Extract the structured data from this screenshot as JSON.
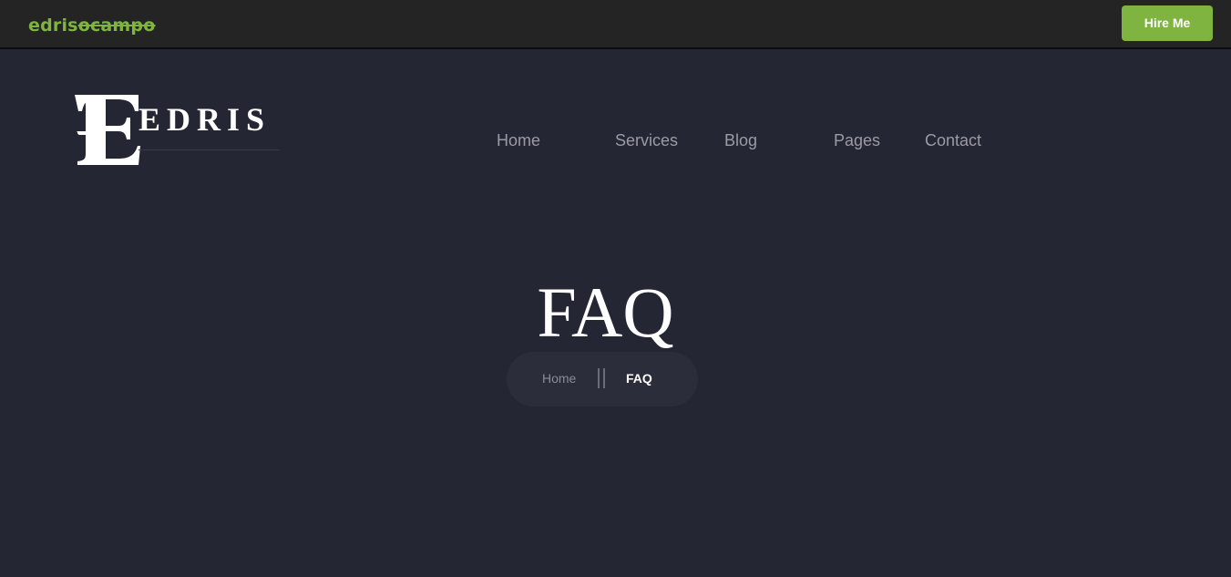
{
  "topbar": {
    "brand_prefix": "edris",
    "brand_suffix": "ocampo",
    "hire_button": "Hire Me"
  },
  "logo": {
    "monogram": "E",
    "text": "EDRIS"
  },
  "nav": {
    "items": [
      "Home",
      "Services",
      "Blog",
      "Pages",
      "Contact"
    ]
  },
  "hero": {
    "title": "FAQ",
    "breadcrumb": {
      "home": "Home",
      "current": "FAQ"
    }
  },
  "colors": {
    "accent": "#7eb43f",
    "background": "#252634",
    "topbar": "#242424"
  }
}
